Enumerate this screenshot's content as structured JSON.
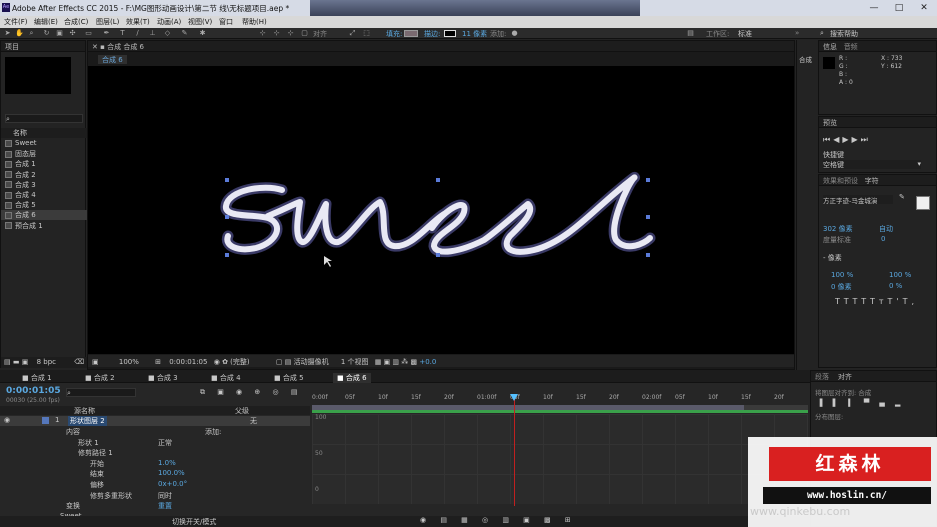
{
  "window": {
    "title": "Adobe After Effects CC 2015 - F:\\MG图形动画设计\\第二节 线\\无标题项目.aep *",
    "app_icon": "Ae",
    "controls": [
      "—",
      "□",
      "✕"
    ]
  },
  "menu": [
    "文件(F)",
    "编辑(E)",
    "合成(C)",
    "图层(L)",
    "效果(T)",
    "动画(A)",
    "视图(V)",
    "窗口",
    "帮助(H)"
  ],
  "toolbar": {
    "align_label": "对齐",
    "fill_label": "填充:",
    "stroke_label": "描边:",
    "stroke_width": "11 像素",
    "add_label": "添加:",
    "workspace_label": "工作区:",
    "workspace_value": "标准",
    "search_placeholder": "搜索帮助"
  },
  "project": {
    "tab": "项目",
    "columns": [
      "名称"
    ],
    "items": [
      "Sweet",
      "固态层",
      "合成 1",
      "合成 2",
      "合成 3",
      "合成 4",
      "合成 5",
      "合成 6",
      "预合成 1"
    ],
    "selected": "合成 6",
    "bpc": "8 bpc"
  },
  "composition": {
    "panel_tab": "合成 合成 6",
    "viewer_tab": "合成 6",
    "footer": {
      "zoom": "100%",
      "time": "0:00:01:05",
      "resolution": "(完整)",
      "camera": "活动摄像机",
      "views": "1 个视图",
      "offset": "+0.0"
    }
  },
  "info_panel": {
    "tabs": [
      "信息",
      "音频"
    ],
    "rgba": [
      "R :",
      "G :",
      "B :",
      "A : 0"
    ],
    "xy": [
      "X : 733",
      "Y : 612"
    ]
  },
  "preview_panel": {
    "tab": "预览",
    "shortcut_label": "快捷键",
    "shortcut_value": "空格键"
  },
  "character_panel": {
    "tabs": [
      "效果和预设",
      "字符"
    ],
    "font": "方正字迹-马金城演",
    "size": "302 像素",
    "leading": "自动",
    "tracking_label": "度量标准",
    "tracking": "0",
    "stroke": "- 像素",
    "vscale": "100 %",
    "hscale": "100 %",
    "baseline": "0 像素",
    "tsume": "0 %",
    "styles": [
      "T",
      "T",
      "TT",
      "Tт",
      "T'",
      "T,"
    ]
  },
  "paragraph_panel": {
    "tabs": [
      "段落",
      "对齐"
    ],
    "align_to_label": "将图层对齐到:",
    "align_to": "合成",
    "distribute_label": "分布图层:"
  },
  "timeline": {
    "tabs": [
      "合成 1",
      "合成 2",
      "合成 3",
      "合成 4",
      "合成 5",
      "合成 6"
    ],
    "active_tab": "合成 6",
    "current_time": "0:00:01:05",
    "fps_info": "00030 (25.00 fps)",
    "search_placeholder": "",
    "columns": [
      "源名称",
      "父级"
    ],
    "layers": [
      {
        "num": "1",
        "name": "形状图层 2",
        "parent": "无"
      }
    ],
    "properties": [
      {
        "name": "内容",
        "value": "",
        "extra": "添加:"
      },
      {
        "name": "形状 1",
        "value": "正常"
      },
      {
        "name": "修剪路径 1",
        "value": ""
      },
      {
        "name": "开始",
        "value": "1.0%"
      },
      {
        "name": "结束",
        "value": "100.0%"
      },
      {
        "name": "偏移",
        "value": "0x+0.0°"
      },
      {
        "name": "修剪多重形状",
        "value": "同时"
      },
      {
        "name": "变换",
        "value": "重置"
      },
      {
        "name": "Sweet",
        "value": ""
      }
    ],
    "footer_label": "切换开关/模式",
    "ruler": [
      "0:00f",
      "05f",
      "10f",
      "15f",
      "20f",
      "01:00f",
      "05f",
      "10f",
      "15f",
      "20f",
      "02:00f",
      "05f",
      "10f",
      "15f",
      "20f"
    ],
    "graph_values": [
      "100",
      "50",
      "0"
    ]
  },
  "watermark": {
    "brand": "红森林",
    "url": "www.hoslin.cn/",
    "background_text": "www.qinkebu.com"
  },
  "colors": {
    "accent": "#5aa8e0",
    "playhead": "#55c0ff",
    "work_area": "#3aa04a",
    "watermark_red": "#d92020"
  }
}
